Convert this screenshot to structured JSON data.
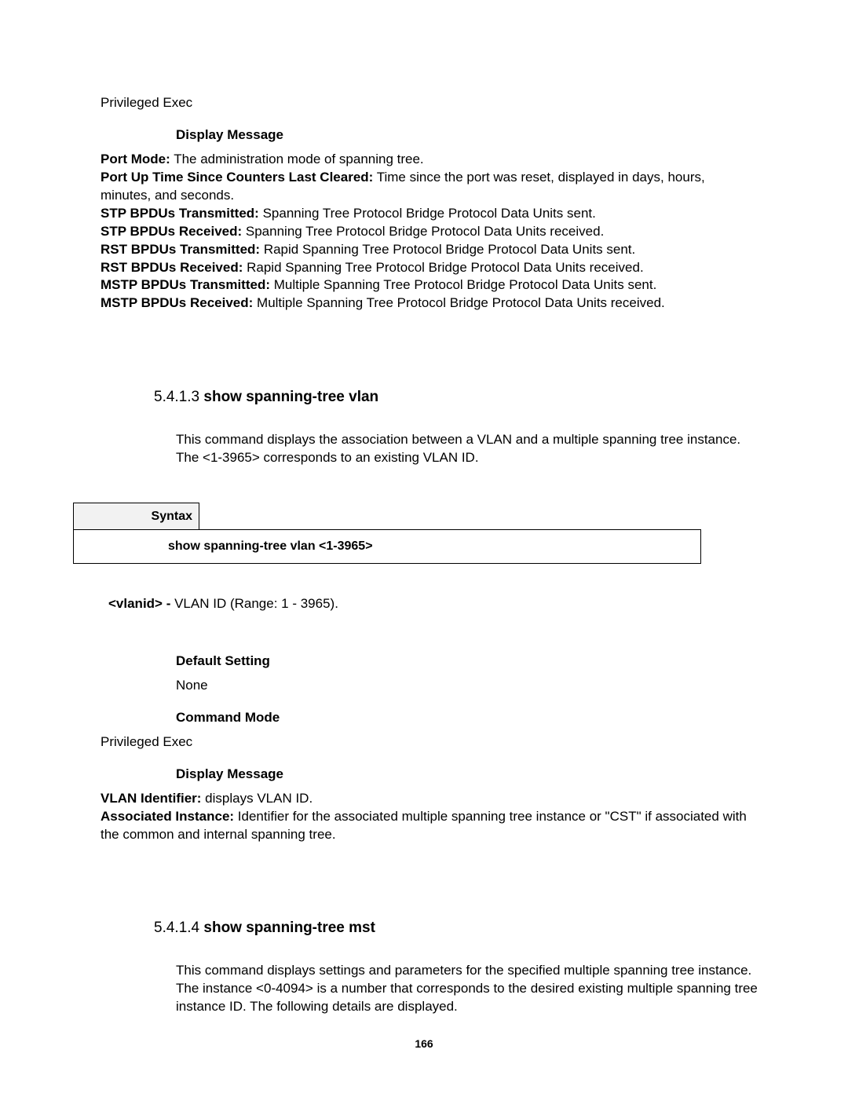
{
  "top_mode": "Privileged Exec",
  "display_message_heading": "Display Message",
  "top_definitions": [
    {
      "term": "Port Mode:",
      "def": " The administration mode of spanning tree."
    },
    {
      "term": "Port Up Time Since Counters Last Cleared:",
      "def": " Time since the port was reset, displayed in days, hours, minutes, and seconds."
    },
    {
      "term": "STP BPDUs Transmitted:",
      "def": " Spanning Tree Protocol Bridge Protocol Data Units sent."
    },
    {
      "term": "STP BPDUs Received:",
      "def": " Spanning Tree Protocol Bridge Protocol Data Units received."
    },
    {
      "term": "RST BPDUs Transmitted:",
      "def": " Rapid Spanning Tree Protocol Bridge Protocol Data Units sent."
    },
    {
      "term": "RST BPDUs Received:",
      "def": " Rapid Spanning Tree Protocol Bridge Protocol Data Units received."
    },
    {
      "term": "MSTP BPDUs Transmitted:",
      "def": " Multiple Spanning Tree Protocol Bridge Protocol Data Units sent."
    },
    {
      "term": "MSTP BPDUs Received:",
      "def": " Multiple Spanning Tree Protocol Bridge Protocol Data Units received."
    }
  ],
  "section_5413": {
    "number": "5.4.1.3 ",
    "title": "show spanning-tree vlan",
    "description": "This command displays the association between a VLAN and a multiple spanning tree instance. The <1-3965> corresponds to an existing VLAN ID.",
    "syntax_label": "Syntax",
    "syntax_command": "show spanning-tree vlan <1-3965>",
    "param_term": "<vlanid> - ",
    "param_def": "VLAN ID (Range: 1 - 3965).",
    "default_setting_label": "Default Setting",
    "default_setting_value": "None",
    "command_mode_label": "Command Mode",
    "command_mode_value": "Privileged Exec",
    "display_message_label": "Display Message",
    "definitions": [
      {
        "term": "VLAN Identifier:",
        "def": " displays VLAN ID."
      },
      {
        "term": "Associated Instance:",
        "def": " Identifier for the associated multiple spanning tree instance or \"CST\" if associated with the common and internal spanning tree."
      }
    ]
  },
  "section_5414": {
    "number": "5.4.1.4 ",
    "title": "show spanning-tree mst",
    "description": "This command displays settings and parameters for the specified multiple spanning tree instance. The instance <0-4094> is a number that corresponds to the desired existing multiple spanning tree instance ID. The following details are displayed."
  },
  "page_number": "166"
}
